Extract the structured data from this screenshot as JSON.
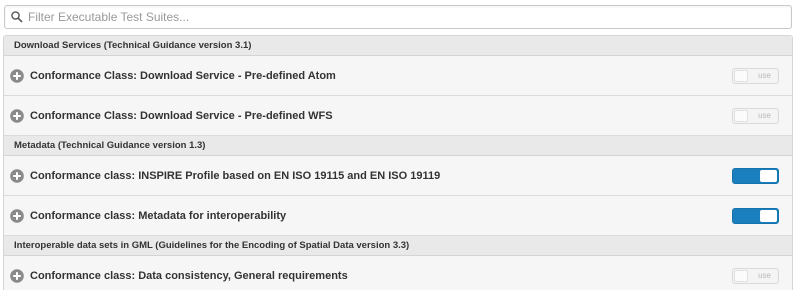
{
  "search": {
    "placeholder": "Filter Executable Test Suites...",
    "icon": "search-icon"
  },
  "colors": {
    "toggle_on": "#1a7fbc",
    "header_bg": "#e9e9e9",
    "row_bg": "#f6f6f6"
  },
  "groups": [
    {
      "title": "Download Services (Technical Guidance version 3.1)",
      "items": [
        {
          "title": "Conformance Class: Download Service - Pre-defined Atom",
          "enabled": false,
          "toggle_label": "use"
        },
        {
          "title": "Conformance Class: Download Service - Pre-defined WFS",
          "enabled": false,
          "toggle_label": "use"
        }
      ]
    },
    {
      "title": "Metadata (Technical Guidance version 1.3)",
      "items": [
        {
          "title": "Conformance class: INSPIRE Profile based on EN ISO 19115 and EN ISO 19119",
          "enabled": true,
          "toggle_label": ""
        },
        {
          "title": "Conformance class: Metadata for interoperability",
          "enabled": true,
          "toggle_label": ""
        }
      ]
    },
    {
      "title": "Interoperable data sets in GML (Guidelines for the Encoding of Spatial Data version 3.3)",
      "items": [
        {
          "title": "Conformance class: Data consistency, General requirements",
          "enabled": false,
          "toggle_label": "use"
        }
      ]
    }
  ]
}
